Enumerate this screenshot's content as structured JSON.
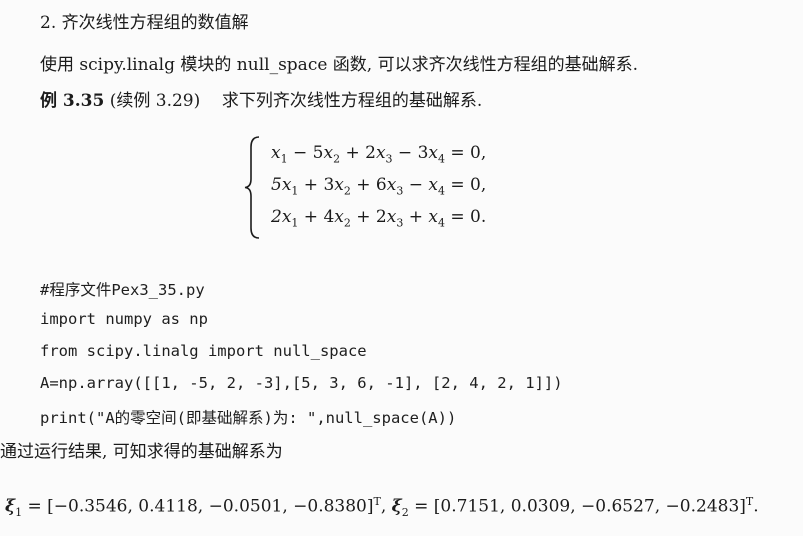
{
  "section_title": "2. 齐次线性方程组的数值解",
  "paragraph": "使用 scipy.linalg 模块的 null_space 函数, 可以求齐次线性方程组的基础解系.",
  "example": {
    "label": "例 3.35",
    "ref": "(续例 3.29)",
    "text": "求下列齐次线性方程组的基础解系."
  },
  "equations": [
    {
      "c1": "x",
      "s1": "1",
      "op1": " − 5",
      "c2": "x",
      "s2": "2",
      "op2": " + 2",
      "c3": "x",
      "s3": "3",
      "op3": " − 3",
      "c4": "x",
      "s4": "4",
      "end": " = 0,"
    },
    {
      "c1": "5x",
      "s1": "1",
      "op1": " + 3",
      "c2": "x",
      "s2": "2",
      "op2": " + 6",
      "c3": "x",
      "s3": "3",
      "op3": " − ",
      "c4": "x",
      "s4": "4",
      "end": " = 0,"
    },
    {
      "c1": "2x",
      "s1": "1",
      "op1": " + 4",
      "c2": "x",
      "s2": "2",
      "op2": " + 2",
      "c3": "x",
      "s3": "3",
      "op3": " + ",
      "c4": "x",
      "s4": "4",
      "end": " = 0."
    }
  ],
  "code_lines": [
    "#程序文件Pex3_35.py",
    "import numpy as np",
    "from scipy.linalg import null_space",
    "A=np.array([[1, -5, 2, -3],[5, 3, 6, -1], [2, 4, 2, 1]])",
    "print(\"A的零空间(即基础解系)为: \",null_space(A))"
  ],
  "result_text": "通过运行结果, 可知求得的基础解系为",
  "solutions": {
    "xi1_symbol": "ξ",
    "xi1_sub": "1",
    "xi1_vec": "[−0.3546, 0.4118, −0.0501, −0.8380]",
    "xi2_symbol": "ξ",
    "xi2_sub": "2",
    "xi2_vec": "[0.7151, 0.0309, −0.6527, −0.2483]",
    "transpose": "T"
  }
}
